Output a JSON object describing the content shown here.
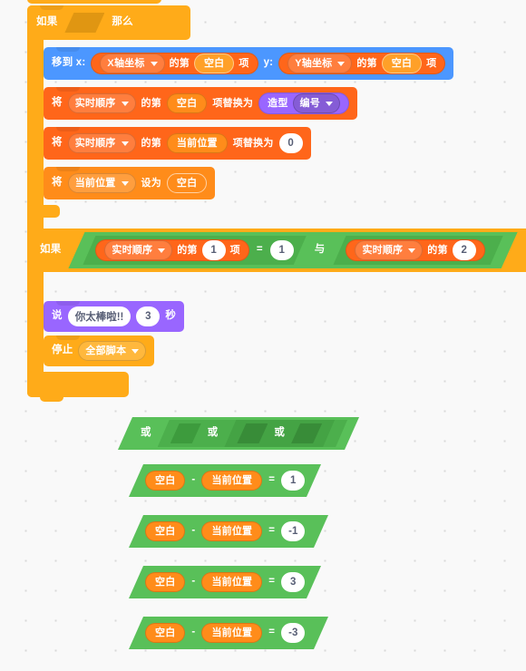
{
  "workspace": {
    "background_color": "#f9f9f9",
    "dot_color": "#d9d9d9"
  },
  "colors": {
    "control": "#FFAB19",
    "motion": "#4C97FF",
    "lists": "#FF661A",
    "variables": "#FF8C1A",
    "looks": "#9966FF",
    "operators": "#59C059"
  },
  "scripts": {
    "if_top": {
      "keyword_if": "如果",
      "keyword_then": "那么"
    },
    "goto_block": {
      "label_move_to_x": "移到 x:",
      "label_y": "y:",
      "x_list": "X轴坐标",
      "x_of_item_a": "的第",
      "x_index": "空白",
      "x_of_item_b": "项",
      "y_list": "Y轴坐标",
      "y_of_item_a": "的第",
      "y_index": "空白",
      "y_of_item_b": "项"
    },
    "replace_costume": {
      "label_set": "将",
      "list_name": "实时顺序",
      "of_item_a": "的第",
      "index": "空白",
      "replace_with": "项替换为",
      "looks_label": "造型",
      "looks_option": "编号"
    },
    "replace_zero": {
      "label_set": "将",
      "list_name": "实时顺序",
      "of_item_a": "的第",
      "index": "当前位置",
      "replace_with": "项替换为",
      "value": "0"
    },
    "set_var": {
      "label_set": "将",
      "var_name": "当前位置",
      "set_to": "设为",
      "value": "空白"
    },
    "if_condition": {
      "keyword_if": "如果",
      "left": {
        "list_name": "实时顺序",
        "of_item_a": "的第",
        "index": "1",
        "of_item_b": "项",
        "operator": "=",
        "compare_value": "1"
      },
      "joiner": "与",
      "right": {
        "list_name": "实时顺序",
        "of_item_a": "的第",
        "index": "2"
      }
    },
    "say_block": {
      "label_say": "说",
      "message": "你太棒啦!!",
      "seconds": "3",
      "label_secs": "秒"
    },
    "stop_block": {
      "label_stop": "停止",
      "option": "全部脚本"
    }
  },
  "loose_blocks": {
    "or_chain": {
      "op1": "或",
      "op2": "或",
      "op3": "或"
    },
    "comparisons": [
      {
        "left": "空白",
        "minus": "-",
        "right": "当前位置",
        "eq": "=",
        "value": "1"
      },
      {
        "left": "空白",
        "minus": "-",
        "right": "当前位置",
        "eq": "=",
        "value": "-1"
      },
      {
        "left": "空白",
        "minus": "-",
        "right": "当前位置",
        "eq": "=",
        "value": "3"
      },
      {
        "left": "空白",
        "minus": "-",
        "right": "当前位置",
        "eq": "=",
        "value": "-3"
      }
    ]
  }
}
